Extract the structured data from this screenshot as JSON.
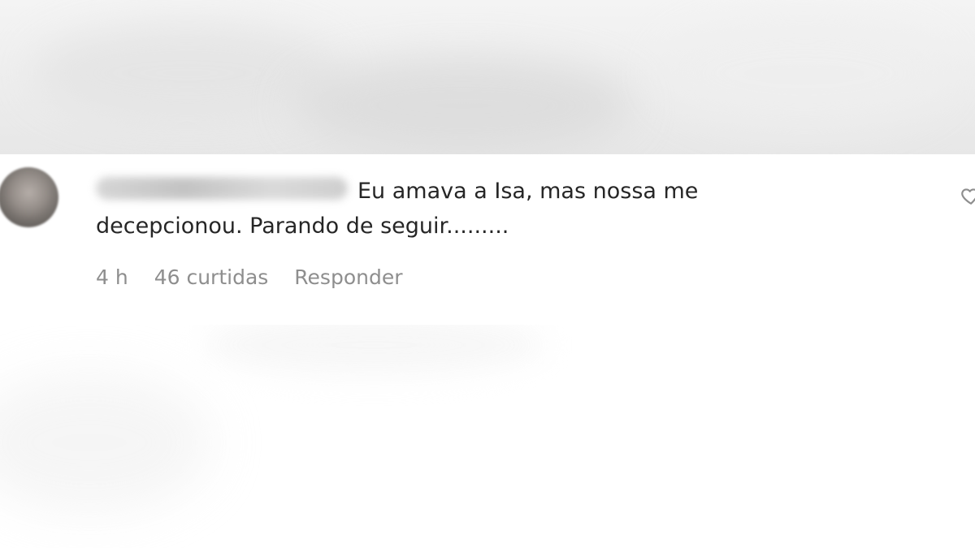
{
  "comment": {
    "text_line_1": "Eu amava a Isa, mas nossa me",
    "text_line_2": "decepcionou. Parando de seguir.........",
    "time": "4 h",
    "likes": "46 curtidas",
    "reply_label": "Responder"
  },
  "icons": {
    "avatar": "profile-avatar",
    "like": "heart-icon"
  },
  "colors": {
    "text": "#262626",
    "meta": "#8e8e8e",
    "background": "#ffffff"
  }
}
